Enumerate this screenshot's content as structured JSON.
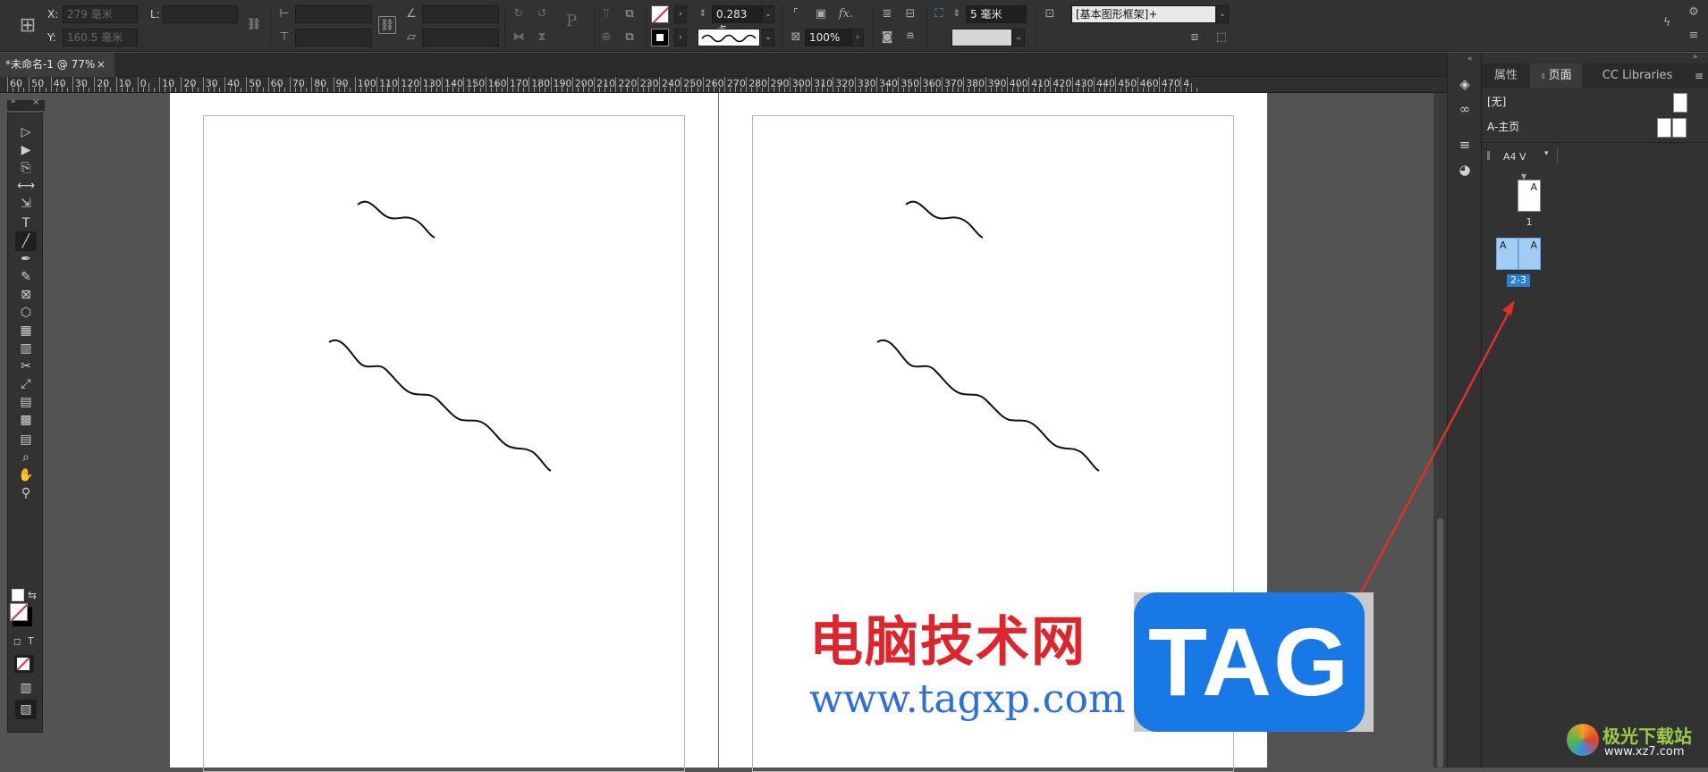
{
  "controlbar": {
    "x_label": "X:",
    "x_value": "279 毫米",
    "y_label": "Y:",
    "y_value": "160.5 毫米",
    "l_label": "L:",
    "stroke_weight": "0.283 点",
    "opacity": "100%",
    "fx_label": "fx.",
    "offset_value": "5 毫米",
    "object_style": "[基本图形框架]+",
    "p_label": "P"
  },
  "document_tab": {
    "title": "*未命名-1 @ 77%",
    "close": "×"
  },
  "ruler": {
    "labels": [
      "60",
      "50",
      "40",
      "30",
      "20",
      "10",
      "0",
      "10",
      "20",
      "30",
      "40",
      "50",
      "60",
      "70",
      "80",
      "90",
      "100",
      "110",
      "120",
      "130",
      "140",
      "150",
      "160",
      "170",
      "180",
      "190",
      "200",
      "210",
      "220",
      "230",
      "240",
      "250",
      "260",
      "270",
      "280",
      "290",
      "300",
      "310",
      "320",
      "330",
      "340",
      "350",
      "360",
      "370",
      "380",
      "390",
      "400",
      "410",
      "420",
      "430",
      "440",
      "450",
      "460",
      "470",
      "4"
    ]
  },
  "tools": [
    {
      "name": "selection-tool-icon",
      "glyph": "▷"
    },
    {
      "name": "direct-selection-tool-icon",
      "glyph": "▶"
    },
    {
      "name": "page-tool-icon",
      "glyph": "⎘"
    },
    {
      "name": "gap-tool-icon",
      "glyph": "⟷"
    },
    {
      "name": "content-collector-icon",
      "glyph": "⇲"
    },
    {
      "name": "type-tool-icon",
      "glyph": "T"
    },
    {
      "name": "line-tool-icon",
      "glyph": "╱"
    },
    {
      "name": "pen-tool-icon",
      "glyph": "✒"
    },
    {
      "name": "pencil-tool-icon",
      "glyph": "✎"
    },
    {
      "name": "rectangle-frame-tool-icon",
      "glyph": "⊠"
    },
    {
      "name": "polygon-tool-icon",
      "glyph": "⬡"
    },
    {
      "name": "table-tool-icon",
      "glyph": "▦"
    },
    {
      "name": "grid-tool-icon",
      "glyph": "▥"
    },
    {
      "name": "scissors-tool-icon",
      "glyph": "✂"
    },
    {
      "name": "free-transform-tool-icon",
      "glyph": "⤢"
    },
    {
      "name": "gradient-swatch-tool-icon",
      "glyph": "▤"
    },
    {
      "name": "gradient-feather-tool-icon",
      "glyph": "▩"
    },
    {
      "name": "note-tool-icon",
      "glyph": "▤"
    },
    {
      "name": "eyedropper-tool-icon",
      "glyph": "⌕"
    },
    {
      "name": "hand-tool-icon",
      "glyph": "✋"
    },
    {
      "name": "zoom-tool-icon",
      "glyph": "⚲"
    }
  ],
  "tool_extra": {
    "format_t": "T"
  },
  "panel": {
    "tabs": [
      "属性",
      "页面",
      "CC Libraries"
    ],
    "master_none": "[无]",
    "master_a": "A-主页",
    "page_size": "A4 V",
    "page1_letter": "A",
    "page1_label": "1",
    "spread_left_letter": "A",
    "spread_right_letter": "A",
    "spread_label": "2-3"
  },
  "watermark": {
    "cn": "电脑技术网",
    "url": "www.tagxp.com",
    "tag": "TAG",
    "site_cn": "极光下载站",
    "site_url": "www.xz7.com"
  },
  "colors": {
    "page_selected": "#a3ccf4",
    "label_selected": "#2d7fd6",
    "arrow": "#e0302b"
  }
}
